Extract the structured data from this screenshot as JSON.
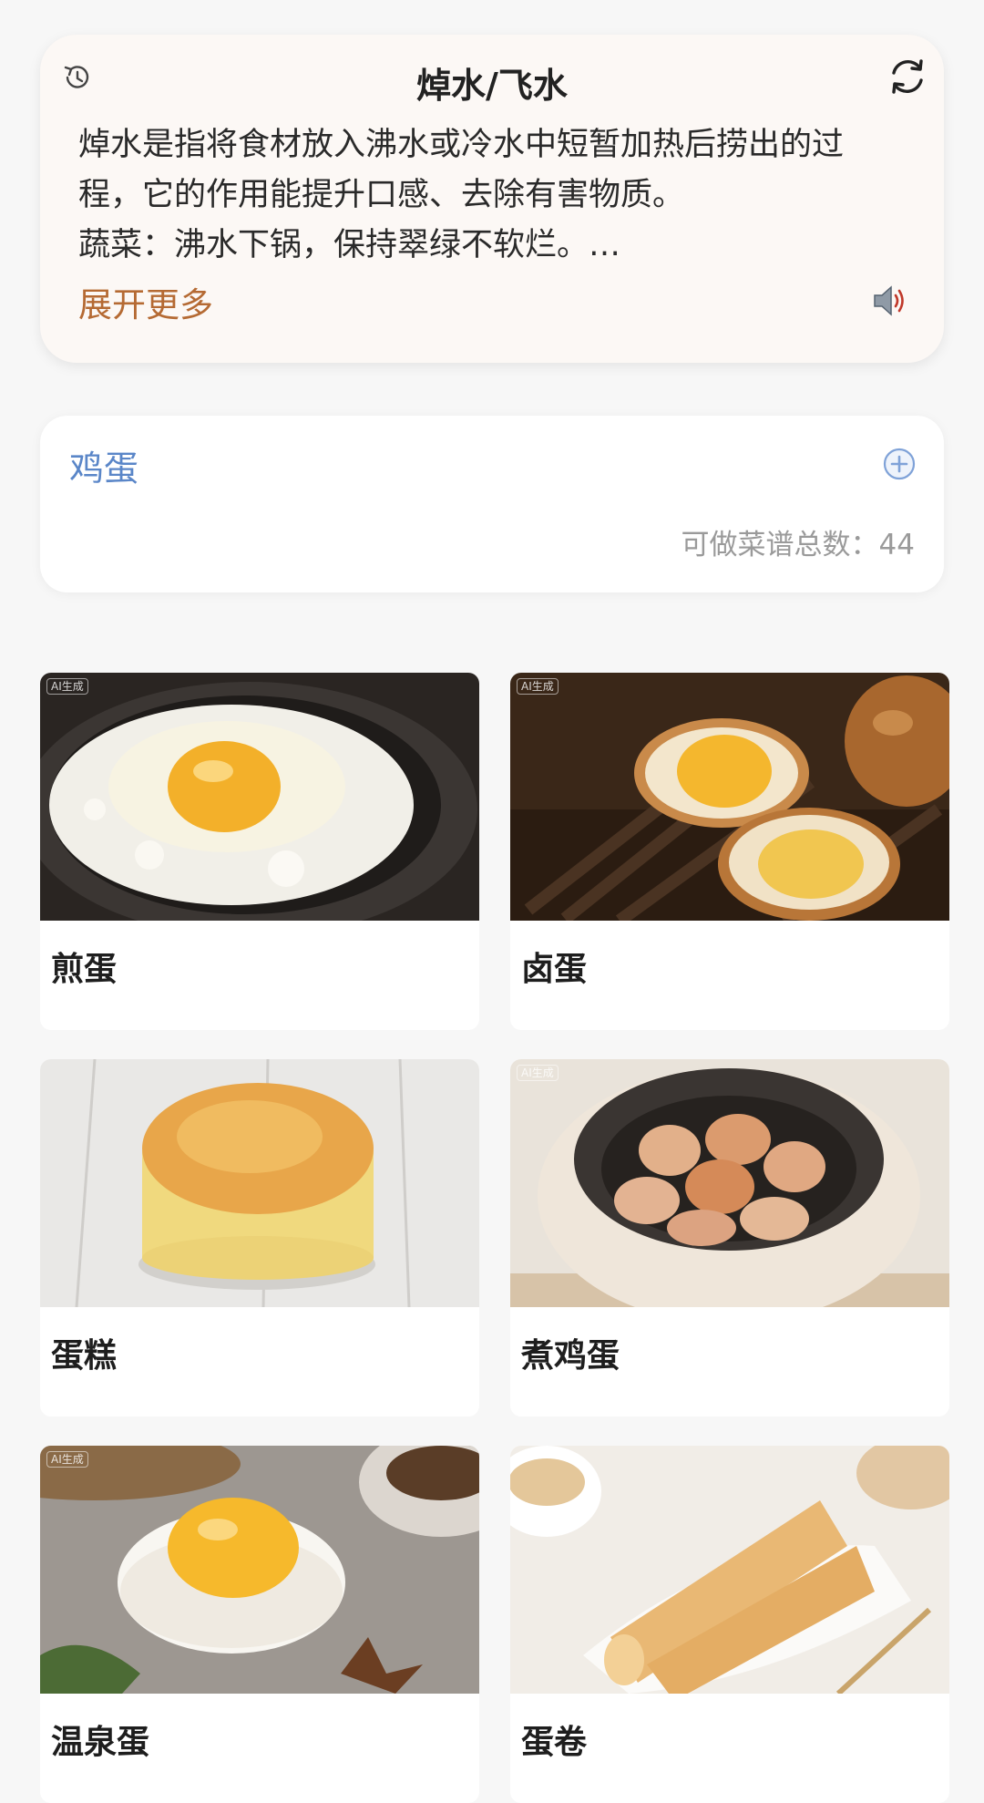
{
  "tip": {
    "title": "焯水/飞水",
    "body_lines": [
      "焯水是指将食材放入沸水或冷水中短暂加热后捞出的过",
      "程，它的作用能提升口感、去除有害物质。",
      "蔬菜：沸水下锅，保持翠绿不软烂。…"
    ],
    "expand_label": "展开更多",
    "icons": {
      "history": "history-icon",
      "refresh": "refresh-icon",
      "speaker": "speaker-icon"
    },
    "accent_color": "#b56a33"
  },
  "ingredient": {
    "tag": "鸡蛋",
    "add_icon": "plus-circle-icon",
    "recipe_count_text": "可做菜谱总数：44",
    "tag_color": "#5a86c8"
  },
  "recipes": [
    {
      "title": "煎蛋",
      "badge": "AI生成",
      "image": "fried-egg-in-pan"
    },
    {
      "title": "卤蛋",
      "badge": "AI生成",
      "image": "braised-eggs"
    },
    {
      "title": "蛋糕",
      "badge": "",
      "image": "sponge-cake"
    },
    {
      "title": "煮鸡蛋",
      "badge": "AI生成",
      "image": "eggs-in-cooker"
    },
    {
      "title": "温泉蛋",
      "badge": "AI生成",
      "image": "soft-boiled-egg-half"
    },
    {
      "title": "蛋卷",
      "badge": "",
      "image": "egg-rolls-on-plate"
    }
  ]
}
